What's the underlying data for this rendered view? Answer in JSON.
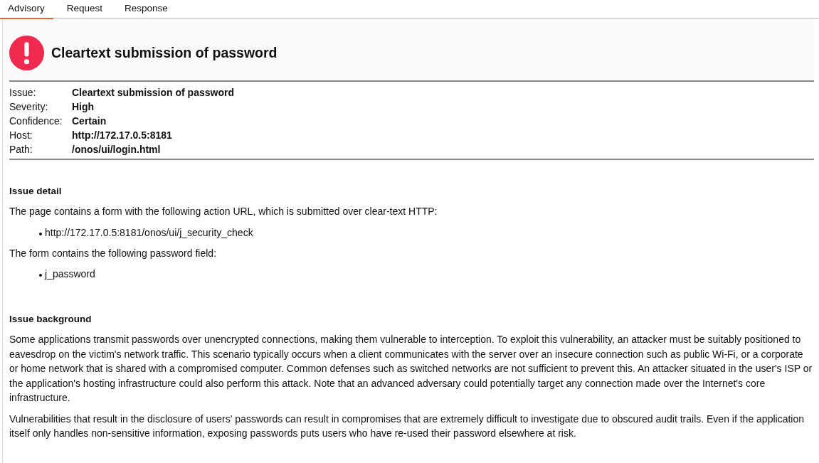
{
  "tabs": [
    {
      "label": "Advisory",
      "selected": true
    },
    {
      "label": "Request",
      "selected": false
    },
    {
      "label": "Response",
      "selected": false
    }
  ],
  "title": "Cleartext submission of password",
  "details": [
    {
      "label": "Issue:",
      "value": "Cleartext submission of password"
    },
    {
      "label": "Severity:",
      "value": "High"
    },
    {
      "label": "Confidence:",
      "value": "Certain"
    },
    {
      "label": "Host:",
      "value": "http://172.17.0.5:8181"
    },
    {
      "label": "Path:",
      "value": "/onos/ui/login.html"
    }
  ],
  "sections": [
    {
      "heading": "Issue detail",
      "blocks": [
        {
          "kind": "paragraph",
          "text": "The page contains a form with the following action URL, which is submitted over clear-text HTTP:"
        },
        {
          "kind": "list",
          "items": [
            "http://172.17.0.5:8181/onos/ui/j_security_check"
          ]
        },
        {
          "kind": "paragraph",
          "text": "The form contains the following password field:"
        },
        {
          "kind": "list",
          "items": [
            "j_password"
          ]
        }
      ]
    },
    {
      "heading": "Issue background",
      "blocks": [
        {
          "kind": "paragraph",
          "text": "Some applications transmit passwords over unencrypted connections, making them vulnerable to interception. To exploit this vulnerability, an attacker must be suitably positioned to eavesdrop on the victim's network traffic. This scenario typically occurs when a client communicates with the server over an insecure connection such as public Wi-Fi, or a corporate or home network that is shared with a compromised computer. Common defenses such as switched networks are not sufficient to prevent this. An attacker situated in the user's ISP or the application's hosting infrastructure could also perform this attack. Note that an advanced adversary could potentially target any connection made over the Internet's core infrastructure."
        },
        {
          "kind": "paragraph",
          "text": "Vulnerabilities that result in the disclosure of users' passwords can result in compromises that are extremely difficult to investigate due to obscured audit trails. Even if the application itself only handles non-sensitive information, exposing passwords puts users who have re-used their password elsewhere at risk."
        }
      ]
    }
  ]
}
